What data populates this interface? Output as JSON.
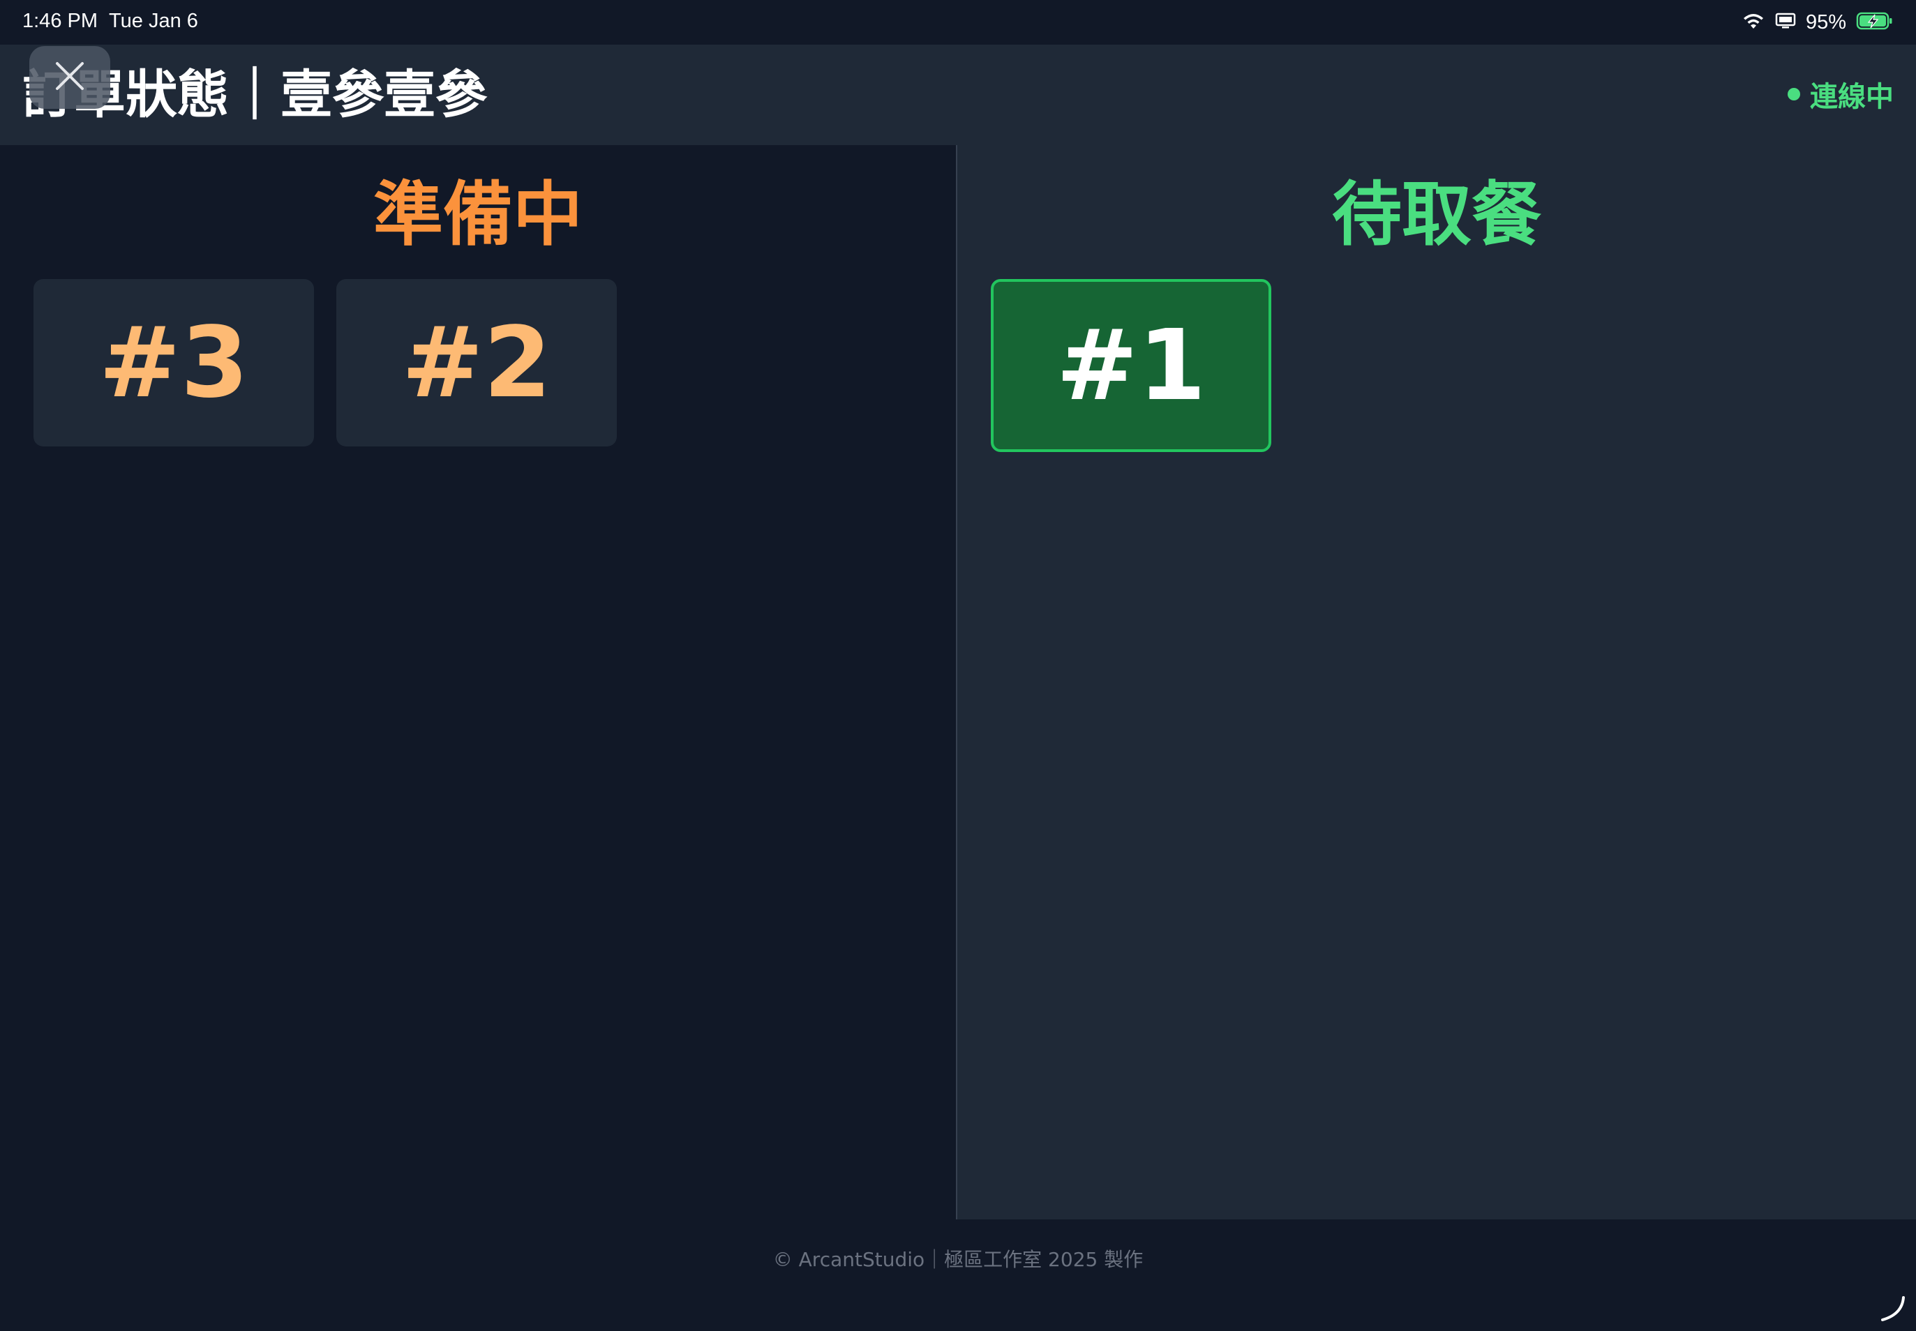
{
  "status_bar": {
    "time": "1:46 PM",
    "date": "Tue Jan 6",
    "battery_percent": "95%",
    "icons": [
      "wifi-icon",
      "screen-mirroring-icon",
      "battery-charging-icon"
    ]
  },
  "header": {
    "title": "訂單狀態｜壹參壹參",
    "close_icon": "close-icon",
    "connection_status": "連線中",
    "connection_color": "#4ade80"
  },
  "columns": {
    "preparing": {
      "title": "準備中",
      "color": "#fb923c",
      "orders": [
        {
          "number": "#3"
        },
        {
          "number": "#2"
        }
      ]
    },
    "ready": {
      "title": "待取餐",
      "color": "#4ade80",
      "orders": [
        {
          "number": "#1"
        }
      ]
    }
  },
  "footer": {
    "text": "© ArcantStudio｜極區工作室 2025 製作"
  }
}
